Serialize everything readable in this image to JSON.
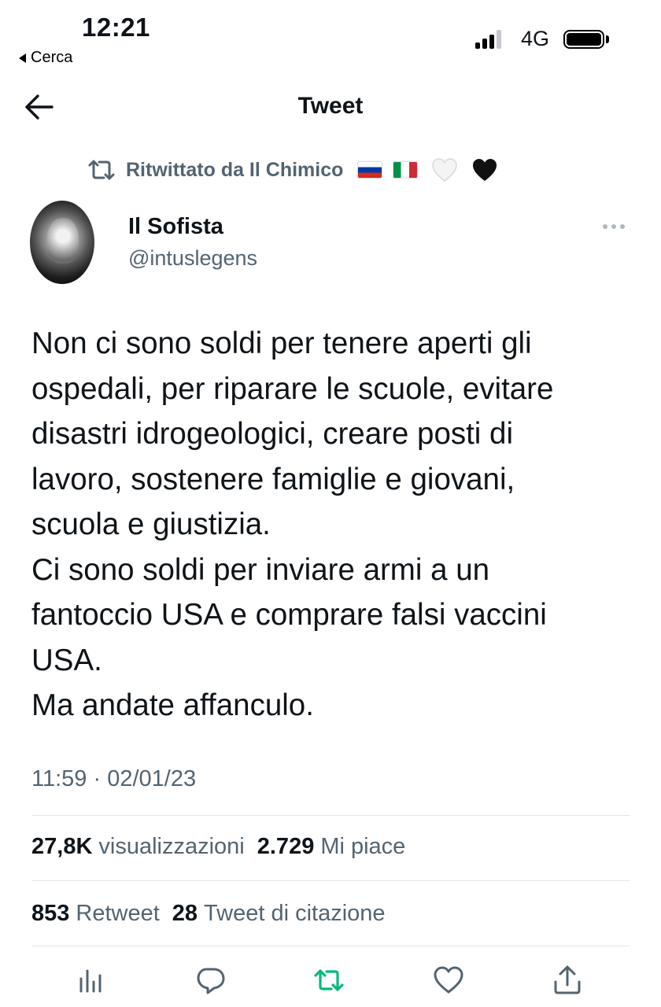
{
  "status_bar": {
    "time": "12:21",
    "back_app": "Cerca",
    "network": "4G"
  },
  "header": {
    "title": "Tweet"
  },
  "retweet": {
    "label": "Ritwittato da Il Chimico"
  },
  "author": {
    "name": "Il Sofista",
    "handle": "@intuslegens"
  },
  "tweet": {
    "lines": [
      "Non ci sono soldi per tenere aperti gli",
      "ospedali, per riparare le scuole, evitare",
      "disastri idrogeologici, creare posti di",
      "lavoro, sostenere famiglie e giovani,",
      "scuola e giustizia.",
      "Ci sono soldi per inviare armi a un",
      "fantoccio USA e comprare falsi vaccini",
      "USA.",
      "Ma andate affanculo."
    ],
    "timestamp": "11:59 · 02/01/23"
  },
  "stats": {
    "views_count": "27,8K",
    "views_label": "visualizzazioni",
    "likes_count": "2.729",
    "likes_label": "Mi piace",
    "retweets_count": "853",
    "retweets_label": "Retweet",
    "quotes_count": "28",
    "quotes_label": "Tweet di citazione"
  },
  "colors": {
    "text": "#0f1419",
    "secondary": "#536471",
    "retweet_green": "#00ba7c",
    "divider": "#e1e6ea"
  },
  "icons": [
    "arrow-left-icon",
    "retweet-icon",
    "more-icon",
    "analytics-icon",
    "reply-icon",
    "retweet-action-icon",
    "like-icon",
    "share-icon"
  ]
}
